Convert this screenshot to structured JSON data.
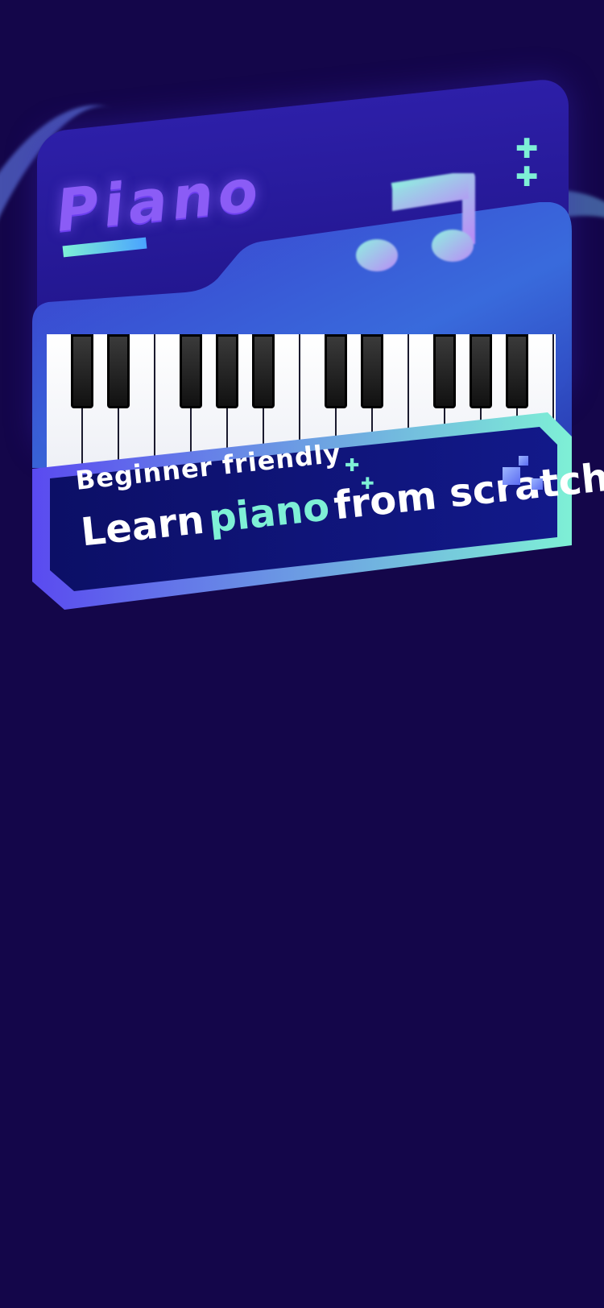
{
  "app": {
    "title": "Piano",
    "subtitle": "Beginner friendly",
    "headline_prefix": "Learn",
    "headline_accent": "piano",
    "headline_suffix": "from scratch"
  },
  "icons": {
    "note": "music-note-icon",
    "plus": "plus-icon"
  },
  "colors": {
    "background": "#14064a",
    "accent": "#7ef0d6",
    "title": "#8b5cf6",
    "banner_fill": "#0e1170"
  }
}
